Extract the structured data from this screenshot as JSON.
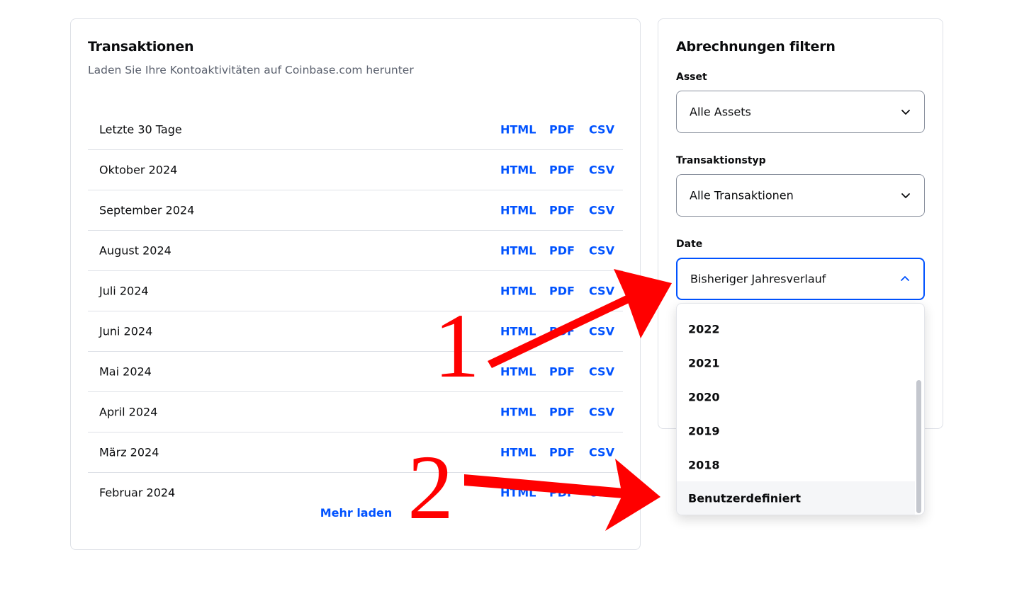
{
  "transactions": {
    "title": "Transaktionen",
    "subtitle": "Laden Sie Ihre Kontoaktivitäten auf Coinbase.com herunter",
    "rows": [
      {
        "label": "Letzte 30 Tage",
        "html": "HTML",
        "pdf": "PDF",
        "csv": "CSV"
      },
      {
        "label": "Oktober 2024",
        "html": "HTML",
        "pdf": "PDF",
        "csv": "CSV"
      },
      {
        "label": "September 2024",
        "html": "HTML",
        "pdf": "PDF",
        "csv": "CSV"
      },
      {
        "label": "August 2024",
        "html": "HTML",
        "pdf": "PDF",
        "csv": "CSV"
      },
      {
        "label": "Juli 2024",
        "html": "HTML",
        "pdf": "PDF",
        "csv": "CSV"
      },
      {
        "label": "Juni 2024",
        "html": "HTML",
        "pdf": "PDF",
        "csv": "CSV"
      },
      {
        "label": "Mai 2024",
        "html": "HTML",
        "pdf": "PDF",
        "csv": "CSV"
      },
      {
        "label": "April 2024",
        "html": "HTML",
        "pdf": "PDF",
        "csv": "CSV"
      },
      {
        "label": "März 2024",
        "html": "HTML",
        "pdf": "PDF",
        "csv": "CSV"
      },
      {
        "label": "Februar 2024",
        "html": "HTML",
        "pdf": "PDF",
        "csv": "CSV"
      }
    ],
    "load_more": "Mehr laden"
  },
  "filters": {
    "title": "Abrechnungen filtern",
    "asset": {
      "label": "Asset",
      "value": "Alle Assets"
    },
    "type": {
      "label": "Transaktionstyp",
      "value": "Alle Transaktionen"
    },
    "date": {
      "label": "Date",
      "value": "Bisheriger Jahresverlauf",
      "options": [
        "2022",
        "2021",
        "2020",
        "2019",
        "2018",
        "Benutzerdefiniert"
      ]
    }
  },
  "annotations": {
    "step1": "1",
    "step2": "2",
    "color": "#ff0000"
  },
  "colors": {
    "link": "#0052ff",
    "border": "#dee1e7",
    "focus": "#0052ff"
  }
}
